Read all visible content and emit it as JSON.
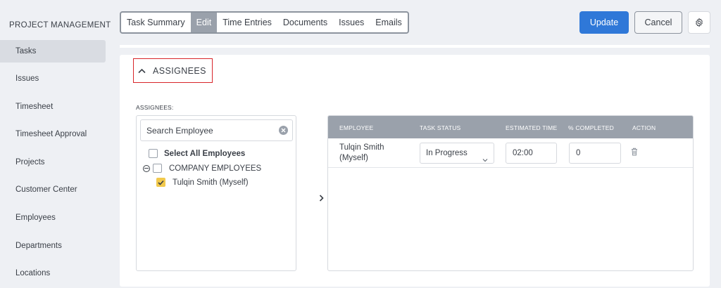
{
  "sidebar": {
    "title": "PROJECT MANAGEMENT",
    "items": [
      {
        "label": "Tasks",
        "active": true
      },
      {
        "label": "Issues"
      },
      {
        "label": "Timesheet"
      },
      {
        "label": "Timesheet Approval"
      },
      {
        "label": "Projects"
      },
      {
        "label": "Customer Center"
      },
      {
        "label": "Employees"
      },
      {
        "label": "Departments"
      },
      {
        "label": "Locations"
      }
    ]
  },
  "tabs": [
    {
      "label": "Task Summary"
    },
    {
      "label": "Edit",
      "active": true
    },
    {
      "label": "Time Entries"
    },
    {
      "label": "Documents"
    },
    {
      "label": "Issues"
    },
    {
      "label": "Emails"
    }
  ],
  "toolbar": {
    "update_label": "Update",
    "cancel_label": "Cancel",
    "settings_icon": "gear-icon"
  },
  "section": {
    "title": "ASSIGNEES",
    "field_label": "ASSIGNEES:"
  },
  "picker": {
    "search_placeholder": "Search Employee",
    "select_all_label": "Select All Employees",
    "group_label": "COMPANY EMPLOYEES",
    "employee_label": "Tulqin Smith (Myself)",
    "employee_checked": true
  },
  "table": {
    "columns": [
      "EMPLOYEE",
      "TASK STATUS",
      "ESTIMATED TIME",
      "% COMPLETED",
      "ACTION"
    ],
    "rows": [
      {
        "employee_line1": "Tulqin Smith",
        "employee_line2": "(Myself)",
        "status": "In Progress",
        "estimated_time": "02:00",
        "percent_completed": "0"
      }
    ]
  },
  "colors": {
    "primary": "#2f78d8",
    "highlight_border": "#d8252a",
    "checkbox_checked": "#f2c94c",
    "header_gray": "#9aa1ab"
  }
}
